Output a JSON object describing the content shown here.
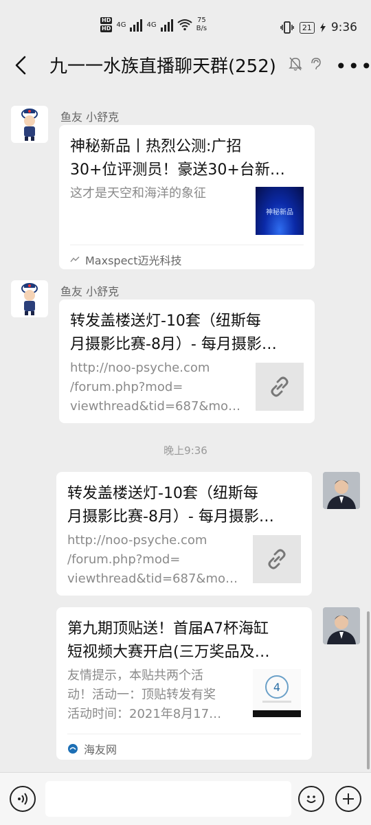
{
  "status_bar": {
    "hd1": "HD",
    "hd2": "HD",
    "net1": "4G",
    "net2": "4G",
    "speed_value": "75",
    "speed_unit": "B/s",
    "battery": "21",
    "time": "9:36"
  },
  "header": {
    "title": "九一一水族直播聊天群(252)"
  },
  "messages": [
    {
      "sender": "鱼友 小舒克",
      "title_line1": "神秘新品丨热烈公测:广招",
      "title_line2": "30+位评测员！豪送30+台新…",
      "desc_line1": "这才是天空和海洋的象征",
      "thumb_text": "神秘新品",
      "source": "Maxspect迈光科技"
    },
    {
      "sender": "鱼友 小舒克",
      "title_line1": "转发盖楼送灯-10套（纽斯每",
      "title_line2": "月摄影比赛-8月）- 每月摄影…",
      "desc_line1": "http://noo-psyche.com",
      "desc_line2": "/forum.php?mod=",
      "desc_line3": "viewthread&tid=687&mo…"
    },
    {
      "title_line1": "转发盖楼送灯-10套（纽斯每",
      "title_line2": "月摄影比赛-8月）- 每月摄影…",
      "desc_line1": "http://noo-psyche.com",
      "desc_line2": "/forum.php?mod=",
      "desc_line3": "viewthread&tid=687&mo…"
    },
    {
      "title_line1": "第九期顶贴送！首届A7杯海缸",
      "title_line2": "短视频大赛开启(三万奖品及…",
      "desc_line1": "友情提示，本贴共两个活",
      "desc_line2": "动！活动一：顶贴转发有奖",
      "desc_line3": "活动时间：2021年8月17…",
      "source": "海友网"
    }
  ],
  "timestamp": "晚上9:36",
  "colors": {
    "background": "#ededed",
    "card": "#ffffff",
    "link_thumb": "#e5e5e5"
  }
}
